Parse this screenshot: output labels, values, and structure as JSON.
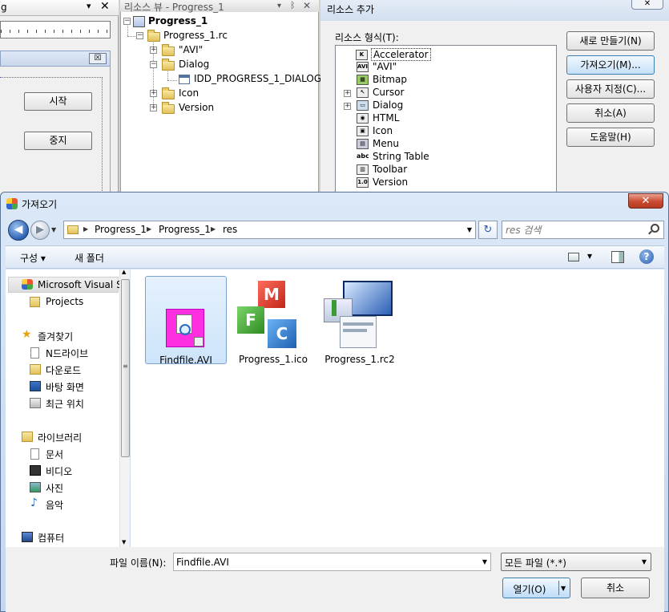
{
  "background": {
    "left_panel": {
      "title_fragment": "g",
      "pin": "▾",
      "close": "✕",
      "dialog_close": "☒",
      "start_button": "시작",
      "stop_button": "중지"
    },
    "resource_view": {
      "title": "리소스 뷰 - Progress_1",
      "controls": [
        "▾",
        "ᛒ",
        "✕"
      ],
      "tree": {
        "root": "Progress_1",
        "rc": "Progress_1.rc",
        "avi": "\"AVI\"",
        "dialog": "Dialog",
        "dialog_item": "IDD_PROGRESS_1_DIALOG",
        "icon": "Icon",
        "version": "Version"
      }
    },
    "add_resource": {
      "title": "리소스 추가",
      "close": "✕",
      "type_label": "리소스 형식(T):",
      "types": [
        "Accelerator",
        "\"AVI\"",
        "Bitmap",
        "Cursor",
        "Dialog",
        "HTML",
        "Icon",
        "Menu",
        "String Table",
        "Toolbar",
        "Version"
      ],
      "type_icons": [
        "K",
        "AVI",
        "▦",
        "↖",
        "▭",
        "◉",
        "▣",
        "▤",
        "abc",
        "▥",
        "1.0"
      ],
      "selected_type": "Accelerator",
      "buttons": [
        "새로 만들기(N)",
        "가져오기(M)...",
        "사용자 지정(C)...",
        "취소(A)",
        "도움말(H)"
      ]
    }
  },
  "dialog": {
    "title": "가져오기",
    "close": "✕",
    "nav": {
      "back": "◀",
      "forward": "▶",
      "dropdown": "▼"
    },
    "breadcrumb": [
      "Progress_1",
      "Progress_1",
      "res"
    ],
    "breadcrumb_sep": "▶",
    "address_dropdown": "▼",
    "refresh": "↻",
    "search_placeholder": "res 검색",
    "toolbar": {
      "organize": "구성 ▾",
      "new_folder": "새 폴더",
      "views_dropdown": "▾",
      "help": "?"
    },
    "sidebar": {
      "top": [
        {
          "label": "Microsoft Visual S",
          "icon": "visual-studio-icon"
        },
        {
          "label": "Projects",
          "icon": "folder-icon"
        }
      ],
      "favorites_title": "즐겨찾기",
      "favorites": [
        "N드라이브",
        "다운로드",
        "바탕 화면",
        "최근 위치"
      ],
      "libraries_title": "라이브러리",
      "libraries": [
        "문서",
        "비디오",
        "사진",
        "음악"
      ],
      "computer": "컴퓨터",
      "scroll_up": "▲",
      "scroll_down": "▼",
      "scroll_grip": "≡"
    },
    "files": [
      {
        "name": "Findfile.AVI",
        "icon": "avi-file-icon",
        "selected": true
      },
      {
        "name": "Progress_1.ico",
        "icon": "mfc-icon-file-icon",
        "selected": false
      },
      {
        "name": "Progress_1.rc2",
        "icon": "rc2-file-icon",
        "selected": false
      }
    ],
    "filename_label": "파일 이름(N):",
    "filename_value": "Findfile.AVI",
    "filetype_value": "모든 파일 (*.*)",
    "open_button": "열기(O)",
    "cancel_button": "취소",
    "colors": {
      "accent": "#3c7fb1",
      "title_bg": "#dbe8f7",
      "close_red": "#c94a30",
      "selection": "#cde4fb"
    }
  }
}
